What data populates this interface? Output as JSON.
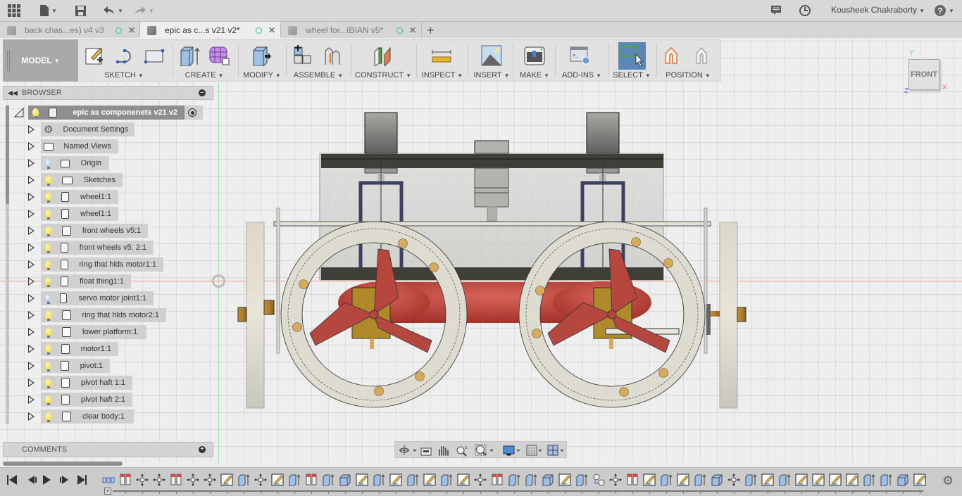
{
  "topbar": {
    "icons": [
      "app-grid-icon",
      "file-icon",
      "save-icon",
      "undo-icon",
      "redo-icon"
    ],
    "notifications_icon": "comment-icon",
    "history_icon": "clock-icon",
    "user_name": "Kousheek Chakraborty",
    "help_icon": "help-icon"
  },
  "tabs": [
    {
      "label": "back chas...es) v4 v3",
      "active": false
    },
    {
      "label": "epic as c...s v21 v2*",
      "active": true
    },
    {
      "label": "wheel for...IBIAN v5*",
      "active": false
    }
  ],
  "new_tab_label": "+",
  "toolbar": {
    "workspace": "MODEL",
    "groups": [
      {
        "label": "SKETCH"
      },
      {
        "label": "CREATE"
      },
      {
        "label": "MODIFY"
      },
      {
        "label": "ASSEMBLE"
      },
      {
        "label": "CONSTRUCT"
      },
      {
        "label": "INSPECT"
      },
      {
        "label": "INSERT"
      },
      {
        "label": "MAKE"
      },
      {
        "label": "ADD-INS"
      },
      {
        "label": "SELECT"
      },
      {
        "label": "POSITION"
      }
    ]
  },
  "browser": {
    "title": "BROWSER",
    "root": "epic as componenets v21 v2",
    "items": [
      {
        "label": "Document Settings",
        "icon": "gear",
        "bulb": null
      },
      {
        "label": "Named Views",
        "icon": "folder",
        "bulb": null
      },
      {
        "label": "Origin",
        "icon": "folder",
        "bulb": "off"
      },
      {
        "label": "Sketches",
        "icon": "folder",
        "bulb": "on"
      },
      {
        "label": "wheel1:1",
        "icon": "component",
        "bulb": "on"
      },
      {
        "label": "wheel1:1",
        "icon": "component",
        "bulb": "on"
      },
      {
        "label": "front wheels v5:1",
        "icon": "body",
        "bulb": "on"
      },
      {
        "label": "front wheels v5: 2:1",
        "icon": "body",
        "bulb": "on"
      },
      {
        "label": "ring that hlds motor1:1",
        "icon": "body",
        "bulb": "on"
      },
      {
        "label": "float thing1:1",
        "icon": "body",
        "bulb": "on"
      },
      {
        "label": "servo motor joint1:1",
        "icon": "body",
        "bulb": "off"
      },
      {
        "label": "ring that hlds motor2:1",
        "icon": "body",
        "bulb": "on"
      },
      {
        "label": "lower platform:1",
        "icon": "body",
        "bulb": "on"
      },
      {
        "label": "motor1:1",
        "icon": "body",
        "bulb": "on"
      },
      {
        "label": "pivot:1",
        "icon": "body",
        "bulb": "on"
      },
      {
        "label": "pivot haft 1:1",
        "icon": "body",
        "bulb": "on"
      },
      {
        "label": "pivot haft 2:1",
        "icon": "body",
        "bulb": "on"
      },
      {
        "label": "clear body:1",
        "icon": "body",
        "bulb": "on"
      }
    ]
  },
  "comments": {
    "title": "COMMENTS"
  },
  "viewcube": {
    "face": "FRONT",
    "axis_x": "X",
    "axis_y": "Y",
    "axis_z": "Z"
  },
  "navbar": {
    "icons": [
      "orbit-icon",
      "look-at-icon",
      "pan-icon",
      "zoom-icon",
      "fit-icon",
      "display-settings-icon",
      "grid-settings-icon",
      "viewports-icon"
    ]
  },
  "timeline": {
    "controls": [
      "skip-start",
      "step-back",
      "play",
      "step-forward",
      "skip-end"
    ],
    "feature_count": 50
  },
  "colors": {
    "accent_select": "#5a87b6",
    "propeller": "#b5473e",
    "float": "#c0443a",
    "brass": "#d9ab58",
    "ring": "#dedbd0",
    "frame_dark": "#3f3f38",
    "bracket": "#3d3f63"
  }
}
